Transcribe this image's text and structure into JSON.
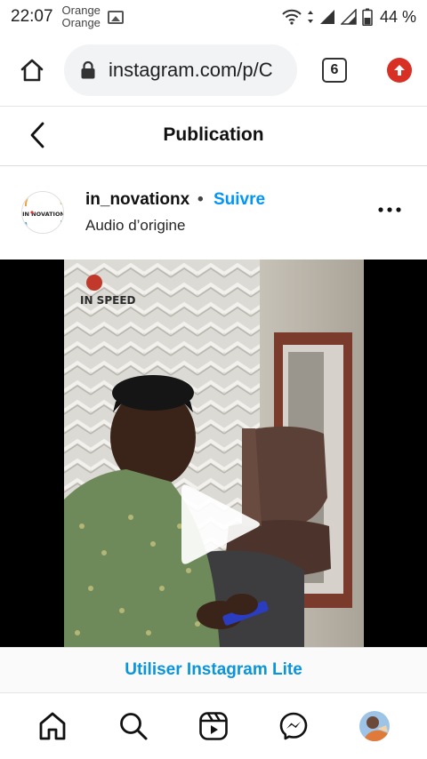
{
  "status_bar": {
    "time": "22:07",
    "carrier_1": "Orange",
    "carrier_2": "Orange",
    "battery": "44 %"
  },
  "browser": {
    "url": "instagram.com/p/C",
    "tab_count": "6"
  },
  "header": {
    "title": "Publication"
  },
  "post": {
    "username": "in_novationx",
    "separator": "•",
    "follow_label": "Suivre",
    "audio": "Audio d’origine"
  },
  "video": {
    "state": "paused"
  },
  "banner": {
    "label": "Utiliser Instagram Lite"
  },
  "bottom_nav": [
    "home-icon",
    "search-icon",
    "reels-icon",
    "messenger-icon",
    "profile-avatar"
  ],
  "colors": {
    "link_blue": "#0095f6",
    "banner_blue": "#0a95db",
    "update_red": "#d93025"
  }
}
